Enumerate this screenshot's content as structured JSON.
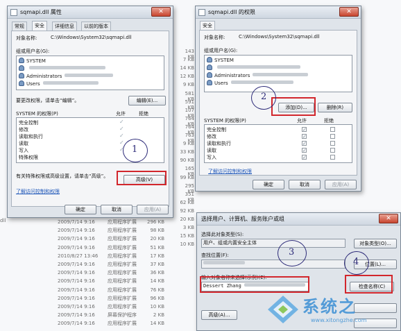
{
  "background": {
    "rows": [
      {
        "date": "2009/7/14 9:16",
        "type": "应用程序扩展",
        "size": "296 KB"
      },
      {
        "date": "2009/7/14 9:16",
        "type": "应用程序扩展",
        "size": "98 KB"
      },
      {
        "date": "2009/7/14 9:16",
        "type": "应用程序扩展",
        "size": "20 KB"
      },
      {
        "date": "2009/7/14 9:16",
        "type": "应用程序扩展",
        "size": "51 KB"
      },
      {
        "date": "2010/8/27 13:46",
        "type": "应用程序扩展",
        "size": "17 KB"
      },
      {
        "date": "2009/7/14 9:16",
        "type": "应用程序扩展",
        "size": "37 KB"
      },
      {
        "date": "2009/7/14 9:16",
        "type": "应用程序扩展",
        "size": "36 KB"
      },
      {
        "date": "2009/7/14 9:16",
        "type": "应用程序扩展",
        "size": "14 KB"
      },
      {
        "date": "2009/7/14 9:16",
        "type": "应用程序扩展",
        "size": "76 KB"
      },
      {
        "date": "2009/7/14 9:16",
        "type": "应用程序扩展",
        "size": "96 KB"
      },
      {
        "date": "2009/7/14 9:16",
        "type": "应用程序扩展",
        "size": "10 KB"
      },
      {
        "date": "2009/7/14 9:16",
        "type": "屏幕保护程序",
        "size": "2 KB"
      },
      {
        "date": "2009/7/14 9:16",
        "type": "应用程序扩展",
        "size": "14 KB"
      }
    ],
    "sizes": [
      "143 KB",
      "7 KB",
      "14 KB",
      "12 KB",
      "9 KB",
      "581 KB",
      "591 KB",
      "107 KB",
      "764 KB",
      "764 KB",
      "763 KB",
      "9 KB",
      "33 KB",
      "90 KB",
      "165 KB",
      "99 KB",
      "295 KB",
      "351 KB",
      "62 KB",
      "92 KB",
      "20 KB",
      "3 KB",
      "15 KB",
      "10 KB"
    ],
    "left_fragment": "dll"
  },
  "props_dialog": {
    "title": "sqmapi.dll 属性",
    "tabs": [
      "常规",
      "安全",
      "详细信息",
      "以前的版本"
    ],
    "object_label": "对象名称:",
    "object_value": "C:\\Windows\\System32\\sqmapi.dll",
    "group_label": "组或用户名(G):",
    "users": [
      "SYSTEM",
      "",
      "Administrators",
      "Users"
    ],
    "change_hint": "要更改权限，请单击“编辑”。",
    "edit_button": "编辑(E)...",
    "perm_header": "SYSTEM 的权限(P)",
    "allow_col": "允许",
    "deny_col": "拒绝",
    "permissions": [
      "完全控制",
      "修改",
      "读取和执行",
      "读取",
      "写入",
      "特殊权限"
    ],
    "advanced_hint": "有关特殊权限或高级设置，请单击“高级”。",
    "advanced_button": "高级(V)",
    "learn_link": "了解访问控制和权限",
    "ok_button": "确定",
    "cancel_button": "取消",
    "apply_button": "应用(A)"
  },
  "perm_dialog": {
    "title": "sqmapi.dll 的权限",
    "tab": "安全",
    "object_label": "对象名称:",
    "object_value": "C:\\Windows\\System32\\sqmapi.dll",
    "group_label": "组或用户名(G):",
    "users": [
      "SYSTEM",
      "",
      "Administrators",
      "Users"
    ],
    "add_button": "添加(D)...",
    "remove_button": "删除(R)",
    "perm_header": "SYSTEM 的权限(P)",
    "allow_col": "允许",
    "deny_col": "拒绝",
    "permissions": [
      "完全控制",
      "修改",
      "读取和执行",
      "读取",
      "写入"
    ],
    "learn_link": "了解访问控制和权限",
    "ok_button": "确定",
    "cancel_button": "取消",
    "apply_button": "应用(A)"
  },
  "select_dialog": {
    "title": "选择用户、计算机、服务账户或组",
    "type_label": "选择此对象类型(S):",
    "type_value": "用户、组或内置安全主体",
    "type_button": "对象类型(O)...",
    "location_label": "查找位置(F):",
    "location_button": "位置(L)...",
    "names_label": "输入对象名称来选择(示例)(E):",
    "names_value": "Dessert Zhang",
    "check_button": "检查名称(C)",
    "advanced_button": "高级(A)..."
  },
  "annotations": [
    "1",
    "2",
    "3",
    "4"
  ],
  "watermark": {
    "brand": "系统之",
    "url": "www.xitongzhe.com"
  },
  "colors": {
    "annotation_red": "#d2262c",
    "annotation_ink": "#2c2a78",
    "link_blue": "#1d56b8"
  }
}
